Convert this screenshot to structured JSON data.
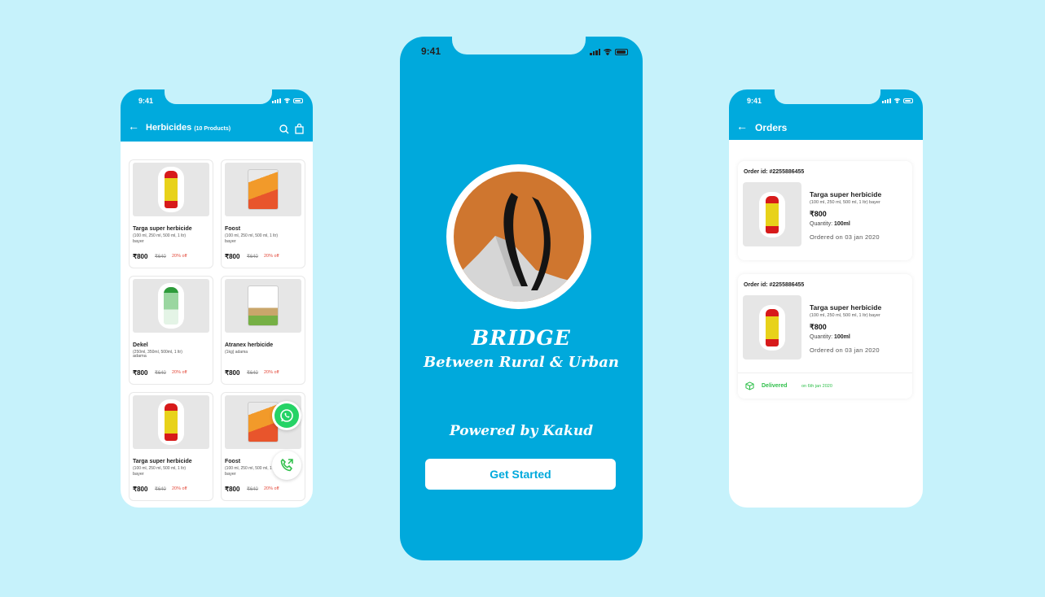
{
  "status": {
    "time": "9:41"
  },
  "catalog": {
    "title": "Herbicides",
    "count": "(10 Products)",
    "products": [
      {
        "name": "Targa super herbicide",
        "sub": "(100 ml, 250 ml, 500 ml, 1 ltr)",
        "brand": "bayer",
        "price": "₹800",
        "mrp": "₹640",
        "off": "20% off",
        "image": "bottle-red"
      },
      {
        "name": "Foost",
        "sub": "(100 ml, 250 ml, 500 ml, 1 ltr)",
        "brand": "bayer",
        "price": "₹800",
        "mrp": "₹640",
        "off": "20% off",
        "image": "pouch-orange"
      },
      {
        "name": "Dekel",
        "sub": "(250ml, 350ml, 500ml, 1 ltr)",
        "brand": "adama",
        "price": "₹800",
        "mrp": "₹640",
        "off": "20% off",
        "image": "bottle-green"
      },
      {
        "name": "Atranex herbicide",
        "sub": "(1kg) adama",
        "brand": "",
        "price": "₹800",
        "mrp": "₹640",
        "off": "20% off",
        "image": "pouch-white"
      },
      {
        "name": "Targa super herbicide",
        "sub": "(100 ml, 250 ml, 500 ml, 1 ltr)",
        "brand": "bayer",
        "price": "₹800",
        "mrp": "₹640",
        "off": "20% off",
        "image": "bottle-red"
      },
      {
        "name": "Foost",
        "sub": "(100 ml, 250 ml, 500 ml, 1 ltr)",
        "brand": "bayer",
        "price": "₹800",
        "mrp": "₹640",
        "off": "20% off",
        "image": "pouch-orange"
      }
    ]
  },
  "splash": {
    "title": "BRIDGE",
    "tagline": "Between Rural & Urban",
    "powered": "Powered by Kakud",
    "cta": "Get Started"
  },
  "orders": {
    "title": "Orders",
    "items": [
      {
        "order_id": "Order id: #2255886455",
        "name": "Targa super herbicide",
        "sub": "(100 ml, 250 ml, 500 ml, 1 ltr) bayer",
        "price": "₹800",
        "qty_label": "Quantity:",
        "qty": "100ml",
        "date": "Ordered on 03 jan 2020"
      },
      {
        "order_id": "Order id: #2255886455",
        "name": "Targa super herbicide",
        "sub": "(100 ml, 250 ml, 500 ml, 1 ltr) bayer",
        "price": "₹800",
        "qty_label": "Quantity:",
        "qty": "100ml",
        "date": "Ordered on 03 jan 2020",
        "status": "Delivered",
        "status_date": "on 6th jan 2020"
      }
    ]
  },
  "colors": {
    "primary": "#00aadd",
    "background": "#c6f2fb",
    "discount": "#e34b3c",
    "delivered": "#2fbf4a",
    "logo_orange": "#cf762f"
  }
}
